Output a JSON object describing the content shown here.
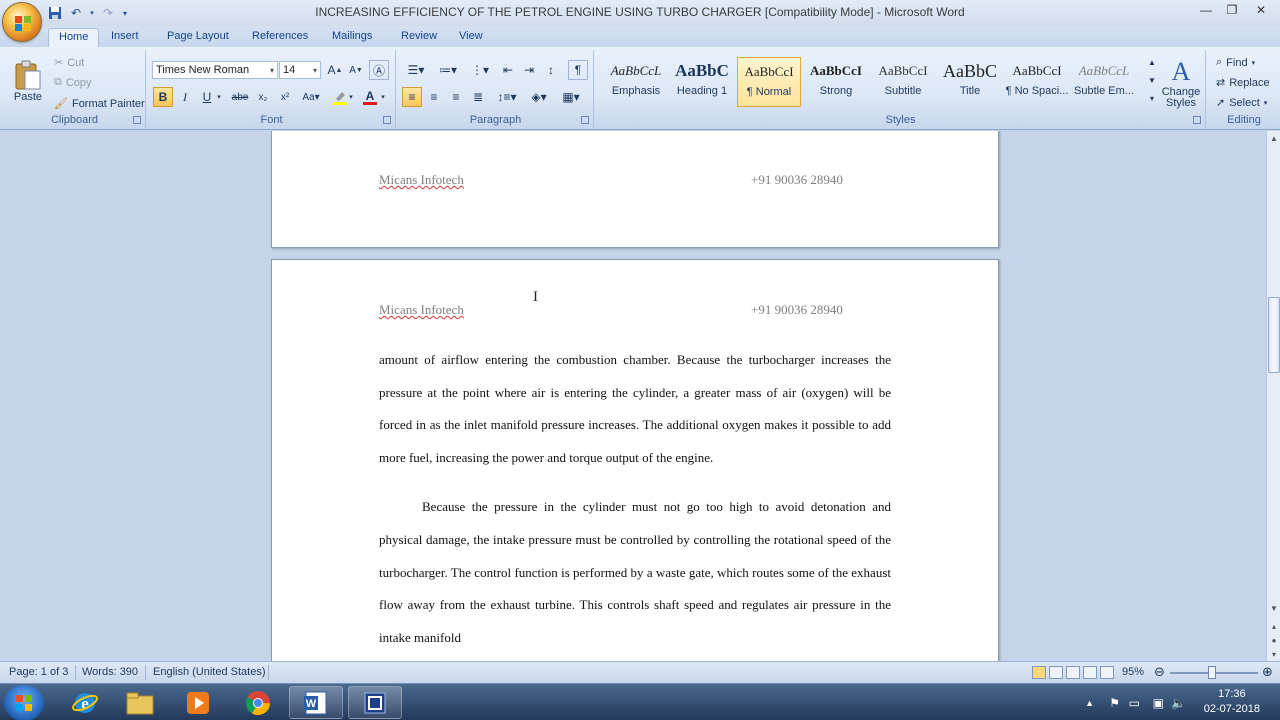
{
  "window": {
    "title": "INCREASING EFFICIENCY OF THE PETROL ENGINE USING TURBO CHARGER [Compatibility Mode] - Microsoft Word"
  },
  "tabs": [
    "Home",
    "Insert",
    "Page Layout",
    "References",
    "Mailings",
    "Review",
    "View"
  ],
  "ribbon": {
    "clipboard": {
      "label": "Clipboard",
      "paste": "Paste",
      "cut": "Cut",
      "copy": "Copy",
      "format_painter": "Format Painter"
    },
    "font": {
      "label": "Font",
      "family": "Times New Roman",
      "size": "14"
    },
    "paragraph": {
      "label": "Paragraph"
    },
    "styles": {
      "label": "Styles",
      "items": [
        {
          "sample": "AaBbCcL",
          "name": "Emphasis"
        },
        {
          "sample": "AaBbC",
          "name": "Heading 1"
        },
        {
          "sample": "AaBbCcI",
          "name": "¶ Normal"
        },
        {
          "sample": "AaBbCcI",
          "name": "Strong"
        },
        {
          "sample": "AaBbCcI",
          "name": "Subtitle"
        },
        {
          "sample": "AaBbC",
          "name": "Title"
        },
        {
          "sample": "AaBbCcI",
          "name": "¶ No Spaci..."
        },
        {
          "sample": "AaBbCcL",
          "name": "Subtle Em..."
        }
      ],
      "change_styles": "Change Styles"
    },
    "editing": {
      "label": "Editing",
      "find": "Find",
      "replace": "Replace",
      "select": "Select"
    }
  },
  "document": {
    "header_left": "Micans Infotech",
    "header_right": "+91 90036 28940",
    "paragraph1": "amount of airflow entering the combustion chamber. Because the turbocharger increases the pressure at the point where air is entering the cylinder, a greater mass of air (oxygen) will be forced in as the inlet manifold pressure increases. The additional oxygen makes it possible to add more fuel, increasing the power and torque output of the engine.",
    "paragraph2": "Because the pressure in the cylinder must not go too high to avoid detonation and physical damage, the intake pressure must be controlled by controlling the rotational speed of the turbocharger. The control function is performed by a waste gate, which routes some of the exhaust flow away from the exhaust turbine. This controls shaft speed and regulates air pressure in the intake manifold"
  },
  "status": {
    "page": "Page: 1 of 3",
    "words": "Words: 390",
    "language": "English (United States)",
    "zoom": "95%"
  },
  "taskbar": {
    "time": "17:36",
    "date": "02-07-2018"
  }
}
